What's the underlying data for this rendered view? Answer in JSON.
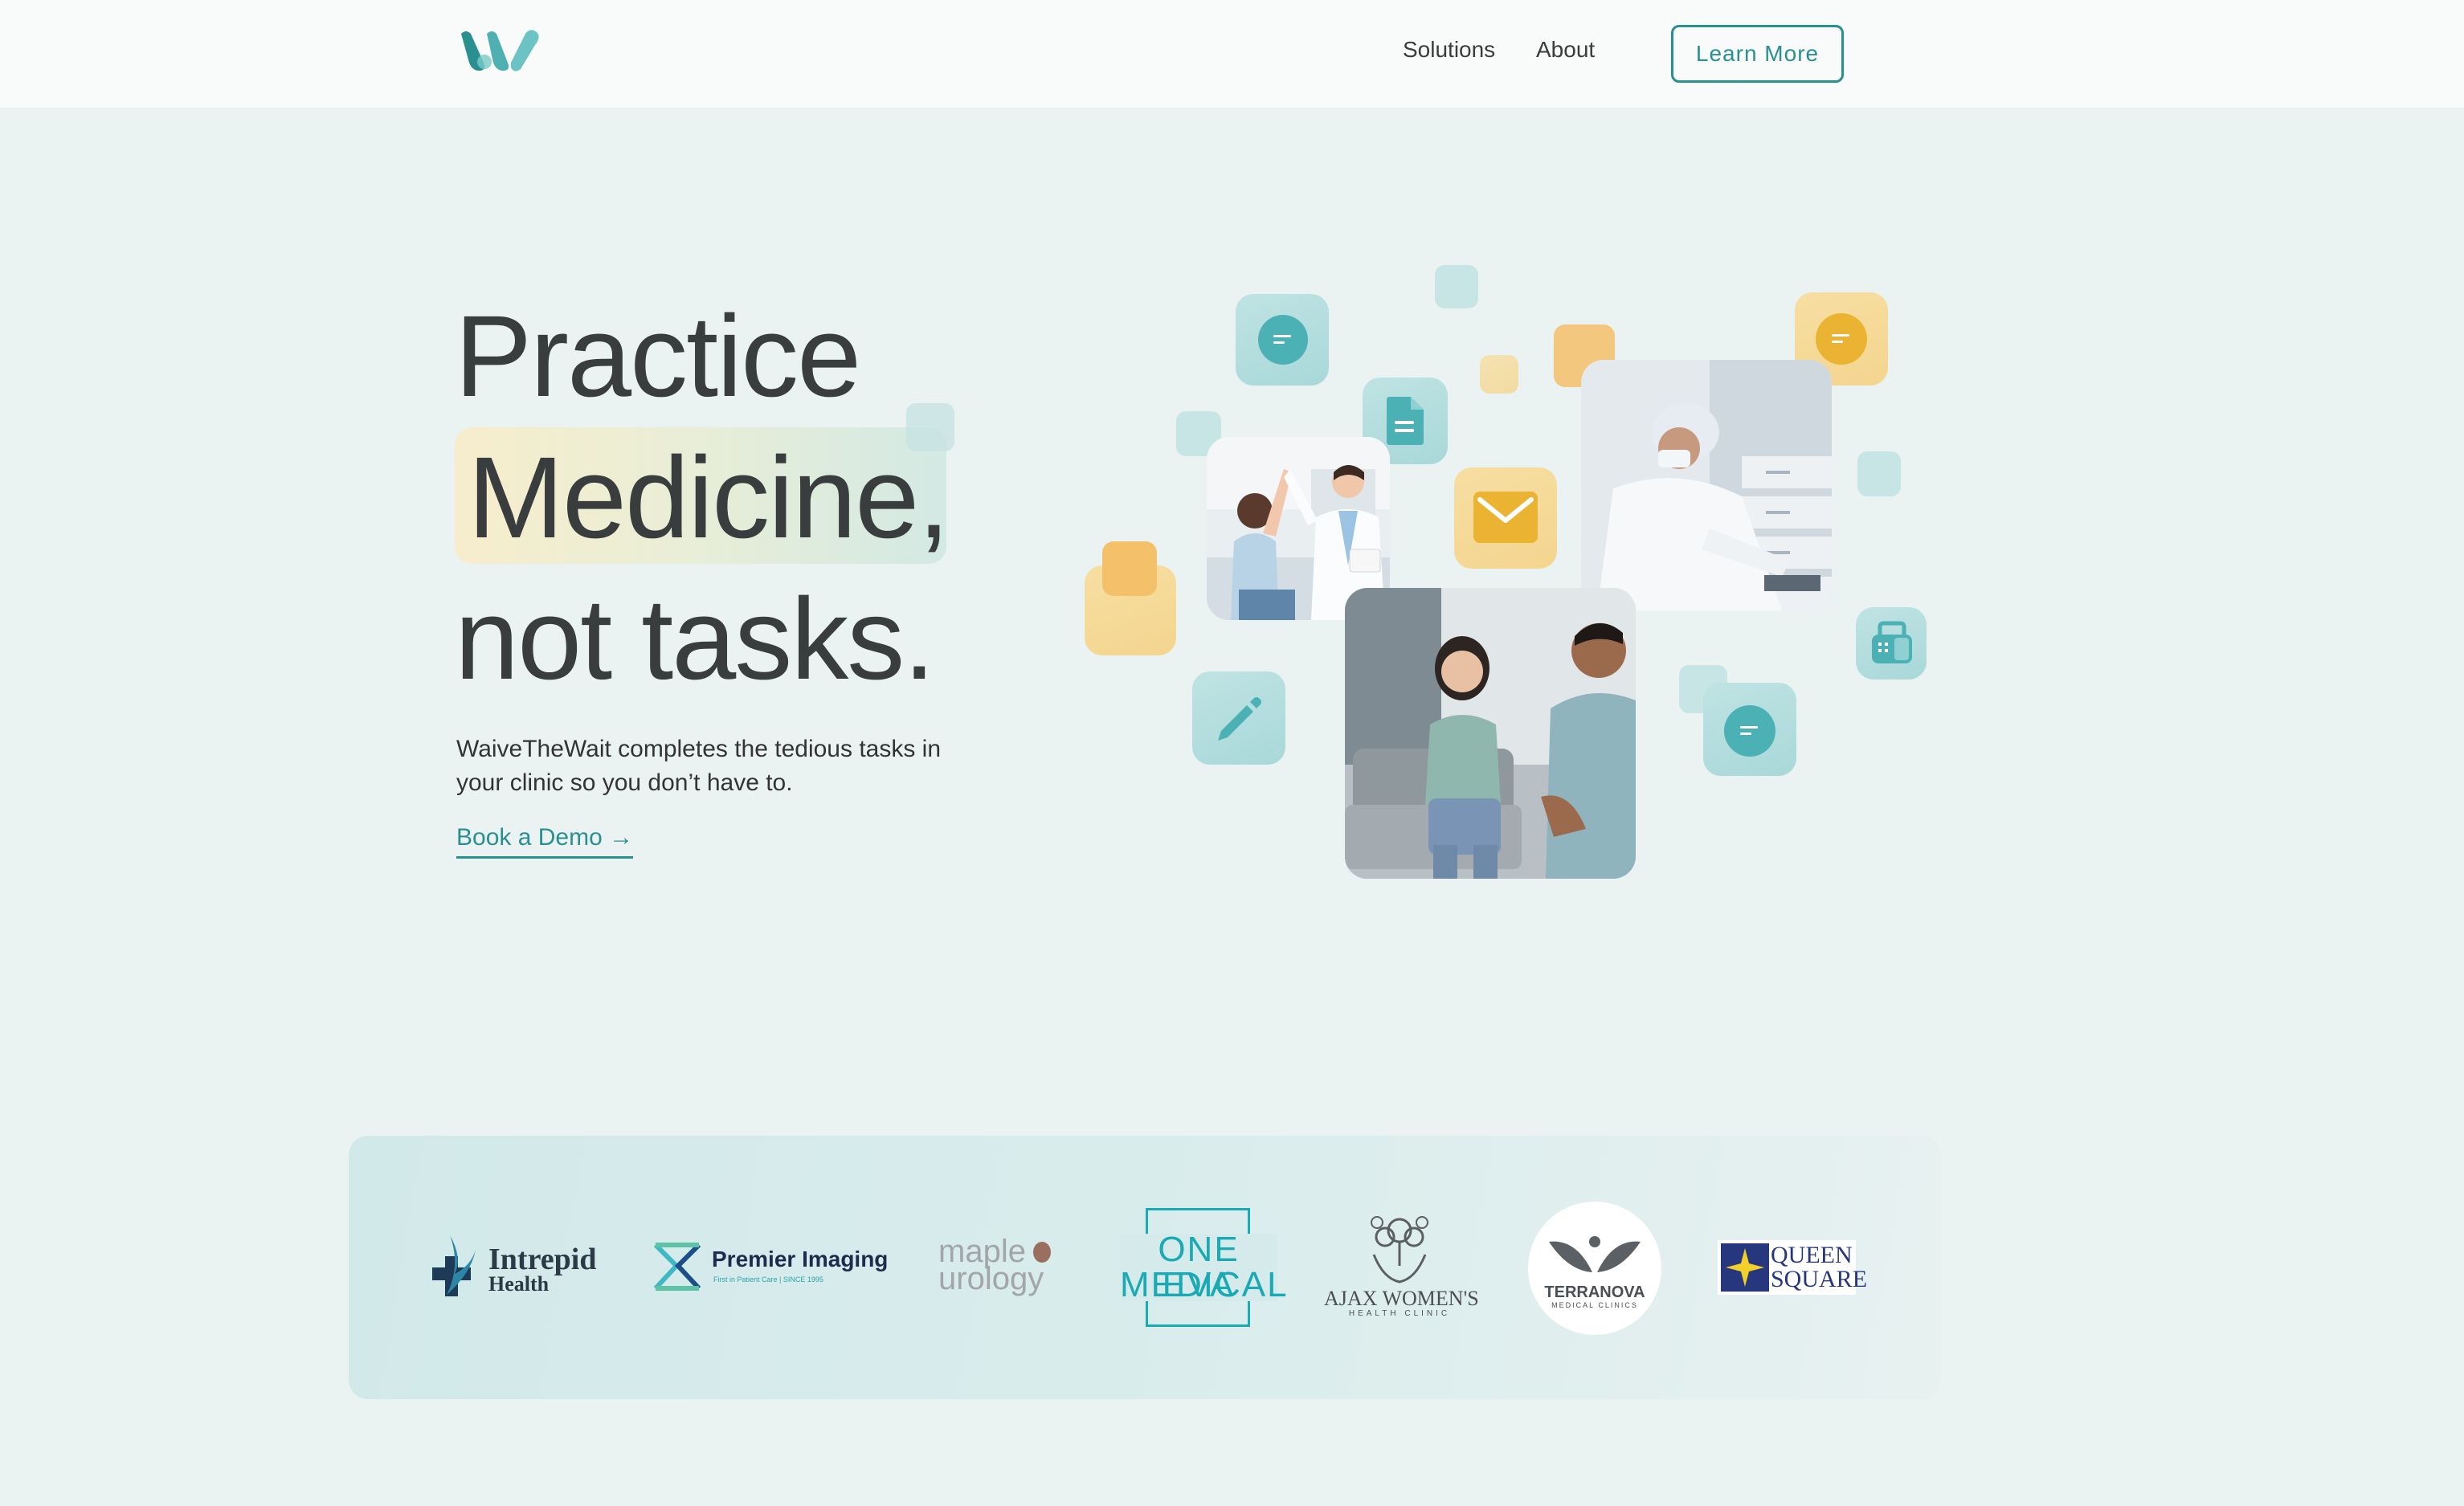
{
  "header": {
    "nav": {
      "solutions": "Solutions",
      "about": "About"
    },
    "cta_label": "Learn More"
  },
  "hero": {
    "line1": "Practice",
    "line2": "Medicine,",
    "line3": "not tasks.",
    "subtitle": "WaiveTheWait completes the tedious tasks in your clinic so you don’t have to.",
    "cta_link": "Book a Demo →"
  },
  "partners": {
    "intrepid": {
      "name": "Intrepid",
      "sub": "Health"
    },
    "premier": {
      "name": "Premier Imaging",
      "tagline": "First in Patient Care | SINCE 1995"
    },
    "maple": {
      "line1": "maple",
      "line2": "urology"
    },
    "oneeva": {
      "line1": "ONE EVA",
      "line2": "MEDICAL"
    },
    "ajax": {
      "name": "AJAX WOMEN'S",
      "sub": "HEALTH CLINIC"
    },
    "terranova": {
      "name": "TERRANOVA",
      "sub": "MEDICAL CLINICS"
    },
    "queen": {
      "line1": "QUEEN",
      "line2": "SQUARE"
    }
  },
  "colors": {
    "brand_teal": "#2a8f91",
    "accent_amber": "#f5c06a",
    "background": "#ebf3f2"
  },
  "icons": [
    "chat-bubble-icon",
    "document-icon",
    "mail-icon",
    "pencil-icon",
    "fax-icon"
  ]
}
